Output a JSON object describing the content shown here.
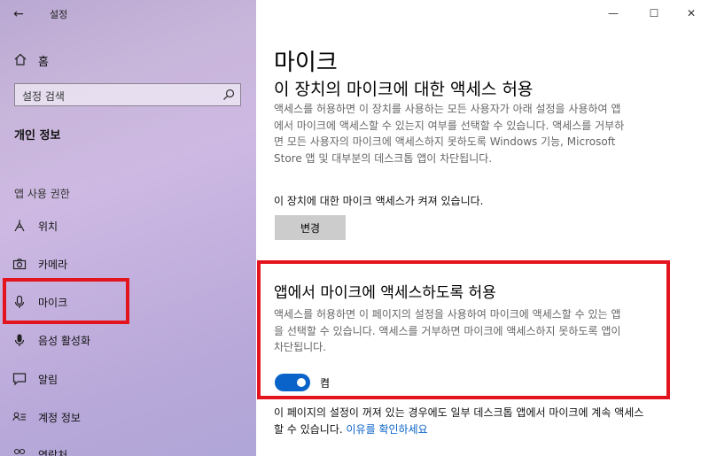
{
  "window": {
    "title": "설정",
    "controls": {
      "minimize": "—",
      "maximize": "☐",
      "close": "✕"
    }
  },
  "sidebar": {
    "home_label": "홈",
    "search_placeholder": "설정 검색",
    "section_title": "개인 정보",
    "group_label": "앱 사용 권한",
    "items": [
      {
        "label": "위치",
        "icon": "location-icon"
      },
      {
        "label": "카메라",
        "icon": "camera-icon"
      },
      {
        "label": "마이크",
        "icon": "microphone-icon",
        "selected": true
      },
      {
        "label": "음성 활성화",
        "icon": "voice-icon"
      },
      {
        "label": "알림",
        "icon": "notification-icon"
      },
      {
        "label": "계정 정보",
        "icon": "account-info-icon"
      },
      {
        "label": "연락처",
        "icon": "contacts-icon"
      }
    ]
  },
  "main": {
    "page_title": "마이크",
    "device_heading": "이 장치의 마이크에 대한 액세스 허용",
    "device_desc": "액세스를 허용하면 이 장치를 사용하는 모든 사용자가 아래 설정을 사용하여 앱에서 마이크에 액세스할 수 있는지 여부를 선택할 수 있습니다. 액세스를 거부하면 모든 사용자의 마이크에 액세스하지 못하도록 Windows 기능, Microsoft Store 앱 및 대부분의 데스크톱 앱이 차단됩니다.",
    "device_status": "이 장치에 대한 마이크 액세스가 켜져 있습니다.",
    "change_button": "변경",
    "apps_heading": "앱에서 마이크에 액세스하도록 허용",
    "apps_desc": "액세스를 허용하면 이 페이지의 설정을 사용하여 마이크에 액세스할 수 있는 앱을 선택할 수 있습니다. 액세스를 거부하면 마이크에 액세스하지 못하도록 앱이 차단됩니다.",
    "toggle_state": "켬",
    "toggle_on": true,
    "note_text": "이 페이지의 설정이 꺼져 있는 경우에도 일부 데스크톱 앱에서 마이크에 계속 액세스할 수 있습니다.",
    "note_link": "이유를 확인하세요"
  },
  "colors": {
    "accent": "#0a63c9",
    "highlight_box": "#e4141e"
  }
}
